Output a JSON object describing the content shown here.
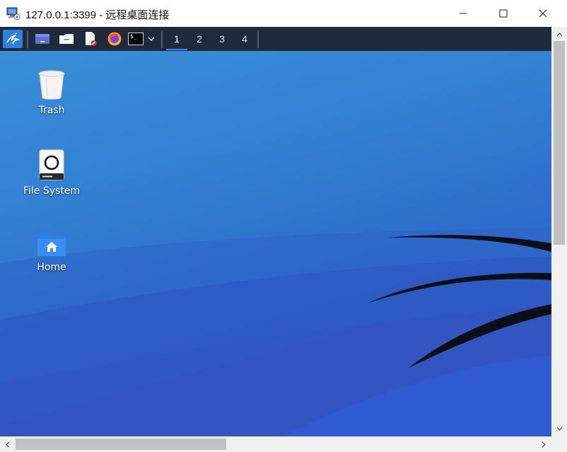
{
  "window": {
    "title": "127.0.0.1:3399 - 远程桌面连接",
    "icon": "remote-desktop-icon",
    "controls": [
      "minimize",
      "maximize",
      "close"
    ]
  },
  "panel": {
    "launchers": [
      {
        "name": "kali-menu-icon"
      },
      {
        "name": "show-desktop-icon"
      },
      {
        "name": "file-manager-icon"
      },
      {
        "name": "text-editor-icon"
      },
      {
        "name": "firefox-icon"
      },
      {
        "name": "terminal-icon"
      },
      {
        "name": "chevron-down-icon"
      }
    ],
    "terminal_glyph": "$_",
    "workspaces": [
      "1",
      "2",
      "3",
      "4"
    ],
    "active_workspace": "1"
  },
  "desktop": {
    "icons": [
      {
        "label": "Trash",
        "icon": "trash-icon"
      },
      {
        "label": "File System",
        "icon": "drive-icon"
      },
      {
        "label": "Home",
        "icon": "home-folder-icon"
      }
    ],
    "colors": {
      "background": "#2f72cd",
      "panel": "#1f2b3c",
      "accent": "#3b8cf0"
    }
  },
  "scrollbars": {
    "vertical": true,
    "horizontal": true
  }
}
